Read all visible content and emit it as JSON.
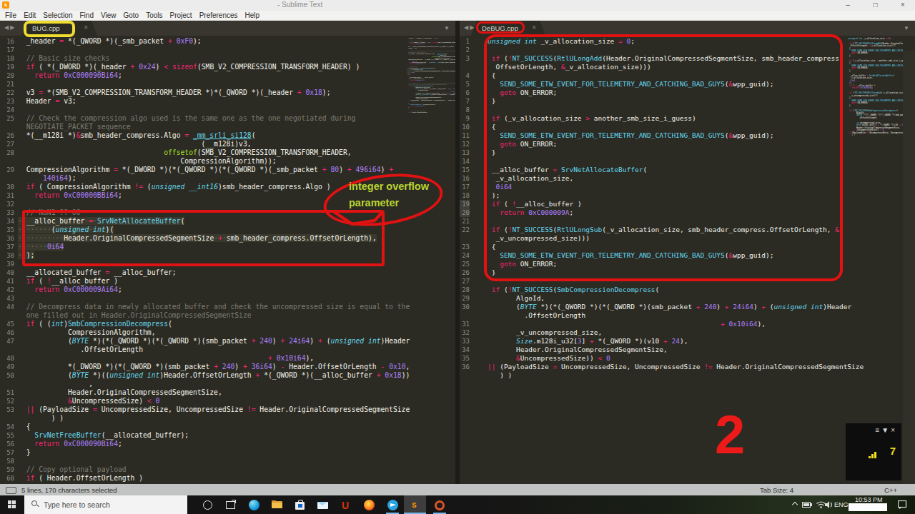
{
  "window": {
    "title": "- Sublime Text",
    "minimize": "–",
    "maximize": "□",
    "close": "×"
  },
  "menu": [
    "File",
    "Edit",
    "Selection",
    "Find",
    "View",
    "Goto",
    "Tools",
    "Project",
    "Preferences",
    "Help"
  ],
  "tab_glyphs": {
    "back": "◀",
    "forward": "▶",
    "close": "×",
    "dropdown": "▼"
  },
  "panes": [
    {
      "tab": "BUG.cpp",
      "rows": [
        {
          "n": "16",
          "t": "  _header = *(_QWORD *)(_smb_packet + 0xF0);"
        },
        {
          "n": "17",
          "t": ""
        },
        {
          "n": "18",
          "t": "  // Basic size checks",
          "c": 1
        },
        {
          "n": "19",
          "t": "  if ( *(_DWORD *)(_header + 0x24) < sizeof(SMB_V2_COMPRESSION_TRANSFORM_HEADER) )"
        },
        {
          "n": "20",
          "t": "    return 0xC000090Bi64;"
        },
        {
          "n": "21",
          "t": ""
        },
        {
          "n": "22",
          "t": "  v3 = *(SMB_V2_COMPRESSION_TRANSFORM_HEADER *)*(_QWORD *)(_header + 0x18);"
        },
        {
          "n": "23",
          "t": "  Header = v3;"
        },
        {
          "n": "24",
          "t": ""
        },
        {
          "n": "25",
          "t": "  // Check the compression algo used is the same one as the one negotiated during",
          "c": 1
        },
        {
          "n": "",
          "t": "  NEGOTIATE_PACKET sequence",
          "c": 1
        },
        {
          "n": "26",
          "t": "  *(__m128i *)&smb_header_compress.Algo = _mm_srli_si128("
        },
        {
          "n": "27",
          "t": "                                            (__m128i)v3,"
        },
        {
          "n": "28",
          "t": "                                   offsetof(SMB_V2_COMPRESSION_TRANSFORM_HEADER,"
        },
        {
          "n": "",
          "t": "                                       CompressionAlgorithm));"
        },
        {
          "n": "29",
          "t": "  CompressionAlgorithm = *(_DWORD *)(*(_QWORD *)(*(_QWORD *)(_smb_packet + 80) + 496i64) +"
        },
        {
          "n": "",
          "t": "      140i64);"
        },
        {
          "n": "30",
          "t": "  if ( CompressionAlgorithm != (unsigned __int16)smb_header_compress.Algo )"
        },
        {
          "n": "31",
          "t": "    return 0xC00000BBi64;"
        },
        {
          "n": "32",
          "t": ""
        },
        {
          "n": "33",
          "t": "  // NaN1 ?? OO",
          "c": 1
        },
        {
          "n": "34",
          "t": "  __alloc_buffer = SrvNetAllocateBuffer(",
          "s": 1
        },
        {
          "n": "35",
          "t": "        (unsigned int)(",
          "s": 1
        },
        {
          "n": "36",
          "t": "           Header.OriginalCompressedSegmentSize + smb_header_compress.OffsetOrLength),",
          "s": 1
        },
        {
          "n": "37",
          "t": "       0i64",
          "s": 1
        },
        {
          "n": "38",
          "t": "  );",
          "s": 1
        },
        {
          "n": "39",
          "t": ""
        },
        {
          "n": "40",
          "t": "  __allocated_buffer = __alloc_buffer;"
        },
        {
          "n": "41",
          "t": "  if ( !__alloc_buffer )"
        },
        {
          "n": "42",
          "t": "    return 0xC000009Ai64;"
        },
        {
          "n": "43",
          "t": ""
        },
        {
          "n": "44",
          "t": "  // Decompress data in newly allocated buffer and check the uncompressed size is equal to the",
          "c": 1
        },
        {
          "n": "",
          "t": "  one filled out in Header.OriginalCompressedSegmentSize",
          "c": 1
        },
        {
          "n": "45",
          "t": "  if ( (int)SmbCompressionDecompress("
        },
        {
          "n": "46",
          "t": "            CompressionAlgorithm,"
        },
        {
          "n": "47",
          "t": "            (BYTE *)(*(_QWORD *)(*(_QWORD *)(smb_packet + 240) + 24i64) + (unsigned int)Header"
        },
        {
          "n": "",
          "t": "               .OffsetOrLength"
        },
        {
          "n": "48",
          "t": "                                                            + 0x10i64),"
        },
        {
          "n": "49",
          "t": "            *(_DWORD *)(*(_QWORD *)(smb_packet + 240) + 36i64) - Header.OffsetOrLength - 0x10,"
        },
        {
          "n": "50",
          "t": "            (BYTE *)((unsigned int)Header.OffsetOrLength + *(_QWORD *)(__alloc_buffer + 0x18))"
        },
        {
          "n": "",
          "t": "                 ,"
        },
        {
          "n": "51",
          "t": "            Header.OriginalCompressedSegmentSize,"
        },
        {
          "n": "52",
          "t": "            &UncompressedSize) < 0"
        },
        {
          "n": "53",
          "t": "  || (PayloadSize = UncompressedSize, UncompressedSize != Header.OriginalCompressedSegmentSize"
        },
        {
          "n": "",
          "t": "        ) )"
        },
        {
          "n": "54",
          "t": "  {"
        },
        {
          "n": "55",
          "t": "    SrvNetFreeBuffer(__allocated_buffer);"
        },
        {
          "n": "56",
          "t": "    return 0xC000090Bi64;"
        },
        {
          "n": "57",
          "t": "  }"
        },
        {
          "n": "58",
          "t": ""
        },
        {
          "n": "59",
          "t": "  // Copy optional payload",
          "c": 1
        },
        {
          "n": "60",
          "t": "  if ( Header.OffsetOrLength )"
        }
      ]
    },
    {
      "tab": "DeBUG.cpp",
      "rows": [
        {
          "n": "1",
          "t": "unsigned int _v_allocation_size = 0;"
        },
        {
          "n": "2",
          "t": ""
        },
        {
          "n": "3",
          "t": " if (!NT_SUCCESS(RtlULongAdd(Header.OriginalCompressedSegmentSize, smb_header_compress."
        },
        {
          "n": "",
          "t": "  OffsetOrLength, &_v_allocation_size)))"
        },
        {
          "n": "4",
          "t": " {"
        },
        {
          "n": "5",
          "t": "   SEND_SOME_ETW_EVENT_FOR_TELEMETRY_AND_CATCHING_BAD_GUYS(&wpp_guid);"
        },
        {
          "n": "6",
          "t": "   goto ON_ERROR;"
        },
        {
          "n": "7",
          "t": " }"
        },
        {
          "n": "8",
          "t": ""
        },
        {
          "n": "9",
          "t": " if (_v_allocation_size > another_smb_size_i_guess)"
        },
        {
          "n": "10",
          "t": " {"
        },
        {
          "n": "11",
          "t": "   SEND_SOME_ETW_EVENT_FOR_TELEMETRY_AND_CATCHING_BAD_GUYS(&wpp_guid);"
        },
        {
          "n": "12",
          "t": "   goto ON_ERROR;"
        },
        {
          "n": "13",
          "t": " }"
        },
        {
          "n": "14",
          "t": ""
        },
        {
          "n": "15",
          "t": " __alloc_buffer = SrvNetAllocateBuffer("
        },
        {
          "n": "16",
          "t": "  _v_allocation_size,"
        },
        {
          "n": "17",
          "t": "  0i64"
        },
        {
          "n": "18",
          "t": " );"
        },
        {
          "n": "19",
          "t": " if ( !__alloc_buffer )",
          "h": 1
        },
        {
          "n": "20",
          "t": "   return 0xC000009A;",
          "h": 1
        },
        {
          "n": "21",
          "t": ""
        },
        {
          "n": "22",
          "t": " if (!NT_SUCCESS(RtlULongSub(_v_allocation_size, smb_header_compress.OffsetOrLength, &"
        },
        {
          "n": "",
          "t": "  _v_uncompressed_size)))"
        },
        {
          "n": "23",
          "t": " {"
        },
        {
          "n": "24",
          "t": "   SEND_SOME_ETW_EVENT_FOR_TELEMETRY_AND_CATCHING_BAD_GUYS(&wpp_guid);"
        },
        {
          "n": "25",
          "t": "   goto ON_ERROR;"
        },
        {
          "n": "26",
          "t": " }"
        },
        {
          "n": "27",
          "t": ""
        },
        {
          "n": "28",
          "t": " if (!NT_SUCCESS(SmbCompressionDecompress("
        },
        {
          "n": "29",
          "t": "       AlgoId,"
        },
        {
          "n": "30",
          "t": "       (BYTE *)(*(_QWORD *)(*(_QWORD *)(smb_packet + 240) + 24i64) + (unsigned int)Header"
        },
        {
          "n": "",
          "t": "         .OffsetOrLength"
        },
        {
          "n": "31",
          "t": "                                                         + 0x10i64),"
        },
        {
          "n": "32",
          "t": "       _v_uncompressed_size,"
        },
        {
          "n": "33",
          "t": "       Size.m128i_u32[3] + *(_QWORD *)(v10 + 24),"
        },
        {
          "n": "34",
          "t": "       Header.OriginalCompressedSegmentSize,"
        },
        {
          "n": "35",
          "t": "       &UncompressedSize)) < 0"
        },
        {
          "n": "36",
          "t": "|| (PayloadSize = UncompressedSize, UncompressedSize != Header.OriginalCompressedSegmentSize"
        },
        {
          "n": "",
          "t": "   ) )"
        }
      ]
    }
  ],
  "status": {
    "left": "5 lines, 170 characters selected",
    "tab_size": "Tab Size: 4",
    "syntax": "C++"
  },
  "taskbar": {
    "search_placeholder": "Type here to search",
    "lang": "ENG",
    "time": "10:53 PM"
  },
  "annotations": {
    "ellipse_line1": "integer overflow",
    "ellipse_line2": "parameter",
    "step_number": "2",
    "panel_value": "7",
    "panel_menu": "≡",
    "panel_dropdown": "▼",
    "panel_close": "×"
  }
}
